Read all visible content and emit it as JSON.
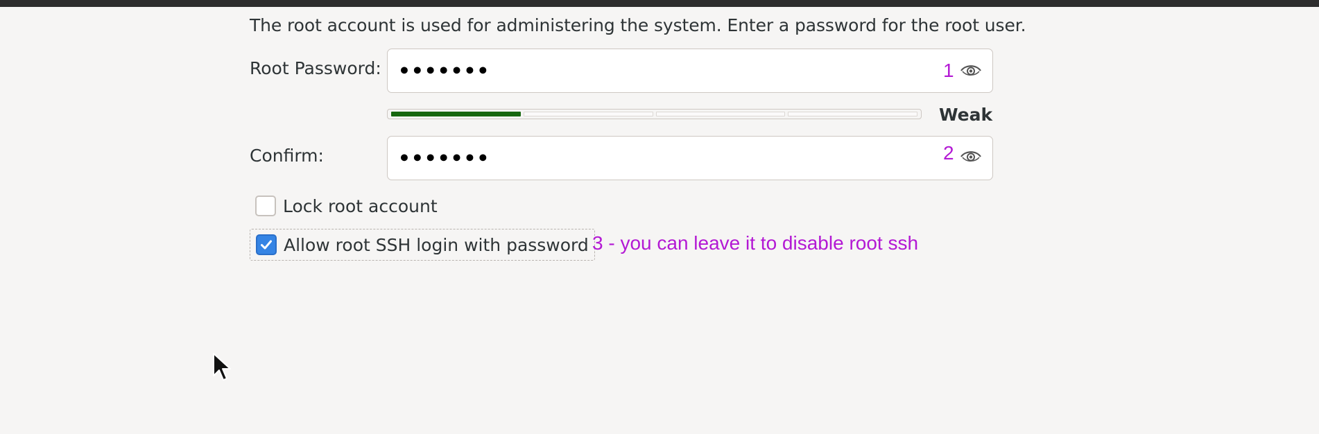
{
  "intro_text": "The root account is used for administering the system.  Enter a password for the root user.",
  "root_password": {
    "label": "Root Password:",
    "masked_value": "•••••••",
    "icon": "eye-icon"
  },
  "strength": {
    "label": "Weak",
    "level": 1,
    "segments": 4,
    "fill_color": "#16670f"
  },
  "confirm": {
    "label": "Confirm:",
    "masked_value": "•••••••",
    "icon": "eye-icon"
  },
  "lock_root": {
    "label": "Lock root account",
    "checked": false
  },
  "allow_ssh": {
    "label": "Allow root SSH login with password",
    "checked": true,
    "accent": "#3584e4"
  },
  "annotations": {
    "num1": "1",
    "num2": "2",
    "note3": "3 - you can leave it to disable root ssh",
    "color": "#b319d4"
  },
  "cursor": "mouse-pointer-icon"
}
